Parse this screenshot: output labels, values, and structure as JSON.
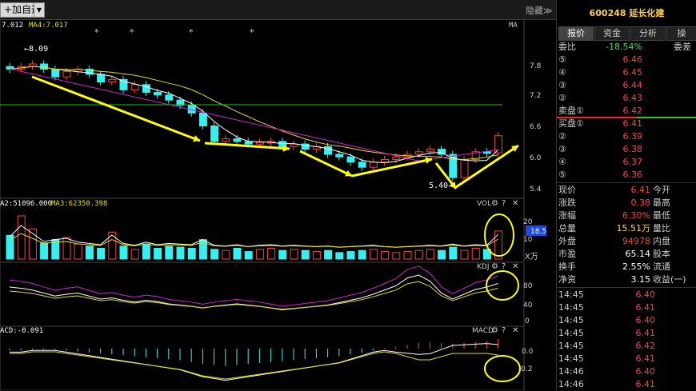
{
  "toolbar": {
    "add_label": "+加自选",
    "dropdown_glyph": "▼",
    "hide_label": "隐藏",
    "hide_glyph": "≫"
  },
  "main_chart": {
    "ma_top_left": "7.012",
    "ma4_label": "MA4:7.017",
    "ma_right_label": "MA",
    "stars": [
      "*",
      "*",
      "*",
      "*"
    ],
    "high_label": "8.09",
    "low_label": "5.40",
    "y_ticks": [
      "7.8",
      "7.2",
      "6.6",
      "6.0",
      "5.4"
    ]
  },
  "volume": {
    "ma2_label": "A2:51096.000",
    "ma3_label": "MA3:62350.398",
    "name": "VOL",
    "y_ticks": [
      "20",
      "10"
    ],
    "current_value": "18.5",
    "unit": "X万"
  },
  "kdj": {
    "name": "KDJ",
    "y_ticks": [
      "80",
      "40",
      "0"
    ]
  },
  "macd": {
    "label": "ACD:-0.091",
    "name": "MACD",
    "y_ticks": [
      "0.0",
      "-0.2"
    ]
  },
  "panel_icons": {
    "settings": "⚙",
    "help": "?",
    "close": "✕"
  },
  "right_panel": {
    "code": "600248",
    "name": "延长化建",
    "tabs": [
      "报价",
      "资金",
      "分析",
      "操"
    ],
    "weibi_label": "委比",
    "weibi_value": "-18.54%",
    "weicha_label": "委差",
    "asks": [
      {
        "level": "⑤",
        "price": "6.46"
      },
      {
        "level": "④",
        "price": "6.45"
      },
      {
        "level": "③",
        "price": "6.44"
      },
      {
        "level": "②",
        "price": "6.43"
      },
      {
        "level": "卖盘①",
        "price": "6.42"
      }
    ],
    "bids": [
      {
        "level": "买盘①",
        "price": "6.41"
      },
      {
        "level": "②",
        "price": "6.39"
      },
      {
        "level": "③",
        "price": "6.38"
      },
      {
        "level": "④",
        "price": "6.37"
      },
      {
        "level": "⑤",
        "price": "6.36"
      }
    ],
    "stats": [
      {
        "l1": "现价",
        "v1": "6.41",
        "c1": "red",
        "l2": "今开",
        "v2": ""
      },
      {
        "l1": "涨跌",
        "v1": "0.38",
        "c1": "red",
        "l2": "最高",
        "v2": ""
      },
      {
        "l1": "涨幅",
        "v1": "6.30%",
        "c1": "red",
        "l2": "最低",
        "v2": ""
      },
      {
        "l1": "总量",
        "v1": "15.51万",
        "c1": "yel",
        "l2": "量比",
        "v2": ""
      },
      {
        "l1": "外盘",
        "v1": "94978",
        "c1": "red",
        "l2": "内盘",
        "v2": ""
      },
      {
        "l1": "市盈",
        "v1": "65.14",
        "c1": "wht",
        "l2": "股本",
        "v2": ""
      },
      {
        "l1": "换手",
        "v1": "2.55%",
        "c1": "wht",
        "l2": "流通",
        "v2": ""
      },
      {
        "l1": "净资",
        "v1": "3.15",
        "c1": "wht",
        "l2": "收益(一)",
        "v2": ""
      }
    ],
    "ticks": [
      {
        "time": "14:45",
        "price": "6.40"
      },
      {
        "time": "14:45",
        "price": "6.41"
      },
      {
        "time": "14:45",
        "price": "6.40"
      },
      {
        "time": "14:45",
        "price": "6.41"
      },
      {
        "time": "14:45",
        "price": "6.42"
      },
      {
        "time": "14:45",
        "price": "6.41"
      },
      {
        "time": "14:46",
        "price": "6.40"
      },
      {
        "time": "14:46",
        "price": "6.41"
      }
    ]
  },
  "colors": {
    "up": "#ff4040",
    "down": "#35f0f0",
    "ma_white": "#ffffff",
    "ma_yellow": "#e6e000",
    "ma_magenta": "#d020d0",
    "ma_green": "#20c020",
    "arrow": "#ffff00"
  }
}
